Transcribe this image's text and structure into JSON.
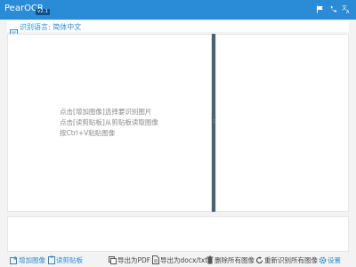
{
  "app": {
    "title": "PearOCR",
    "version": "v2.1"
  },
  "topbar": {
    "icons": [
      "flag-icon",
      "phone-icon",
      "translate-icon"
    ]
  },
  "language": {
    "label": "识别语言: 简体中文"
  },
  "hints": [
    "点击[增加图像]选择要识别图片",
    "点击[读剪贴板]从剪贴板读取图像",
    "按Ctrl+V粘贴图像"
  ],
  "toolbar": {
    "add_image": "增加图像",
    "read_clipboard": "读剪贴板",
    "export_pdf": "导出为PDF",
    "export_docx": "导出为docx/txt",
    "delete_all": "删除所有图像",
    "rerecognize": "重新识别所有图像",
    "settings": "设置"
  },
  "colors": {
    "accent": "#2a8bd6",
    "divider": "#4a6272"
  }
}
